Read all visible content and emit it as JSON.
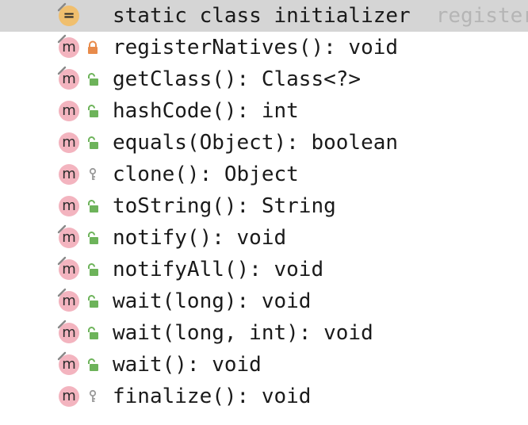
{
  "structure": {
    "header_item": {
      "label": "static class initializer",
      "hint": "registerN",
      "icon": "static-initializer-icon"
    },
    "members": [
      {
        "label": "registerNatives(): void",
        "visibility": "private",
        "overridden": true
      },
      {
        "label": "getClass(): Class<?>",
        "visibility": "public",
        "overridden": true
      },
      {
        "label": "hashCode(): int",
        "visibility": "public",
        "overridden": false
      },
      {
        "label": "equals(Object): boolean",
        "visibility": "public",
        "overridden": false
      },
      {
        "label": "clone(): Object",
        "visibility": "protected",
        "overridden": false
      },
      {
        "label": "toString(): String",
        "visibility": "public",
        "overridden": false
      },
      {
        "label": "notify(): void",
        "visibility": "public",
        "overridden": true
      },
      {
        "label": "notifyAll(): void",
        "visibility": "public",
        "overridden": true
      },
      {
        "label": "wait(long): void",
        "visibility": "public",
        "overridden": true
      },
      {
        "label": "wait(long, int): void",
        "visibility": "public",
        "overridden": true
      },
      {
        "label": "wait(): void",
        "visibility": "public",
        "overridden": true
      },
      {
        "label": "finalize(): void",
        "visibility": "protected",
        "overridden": false
      }
    ],
    "method_badge_letter": "m",
    "init_badge_letter": "=",
    "colors": {
      "selection": "#d5d5d5",
      "method_badge": "#f3b4bf",
      "init_badge": "#f0bf6e",
      "public_lock": "#6db35a",
      "private_lock": "#e88b4b",
      "protected_key": "#9a9a9a",
      "hint_text": "#b5b5b5"
    }
  }
}
